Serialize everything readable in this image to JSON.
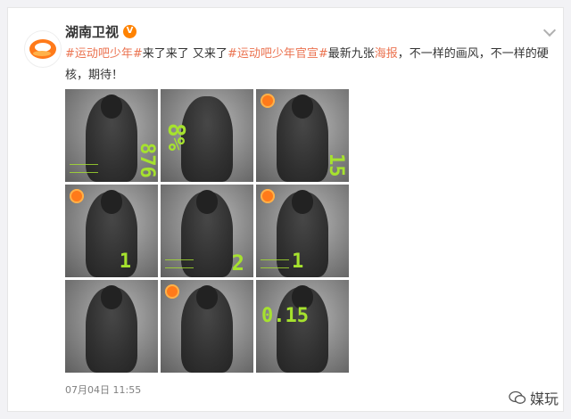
{
  "post": {
    "account_name": "湖南卫视",
    "verified_icon": "verified-v-icon",
    "text_segments": [
      {
        "type": "hashtag",
        "text": "#运动吧少年#"
      },
      {
        "type": "text",
        "text": "来了来了 又来了"
      },
      {
        "type": "hashtag",
        "text": "#运动吧少年官宣#"
      },
      {
        "type": "text",
        "text": "最新九张"
      },
      {
        "type": "link",
        "text": "海报"
      },
      {
        "type": "text",
        "text": "，不一样的画风，不一样的硬核，期待！"
      }
    ],
    "timestamp": "07月04日 11:55",
    "images": [
      {
        "stat": "876"
      },
      {
        "stat": "8%"
      },
      {
        "stat": "15"
      },
      {
        "stat": "1"
      },
      {
        "stat": "2"
      },
      {
        "stat": "1"
      },
      {
        "stat": ""
      },
      {
        "stat": ""
      },
      {
        "stat": "0.15"
      }
    ]
  },
  "watermark": {
    "text": "媒玩",
    "icon": "wechat-icon"
  },
  "colors": {
    "link": "#eb7350",
    "accent": "#a6e22e",
    "brand": "#ff7a1a"
  }
}
